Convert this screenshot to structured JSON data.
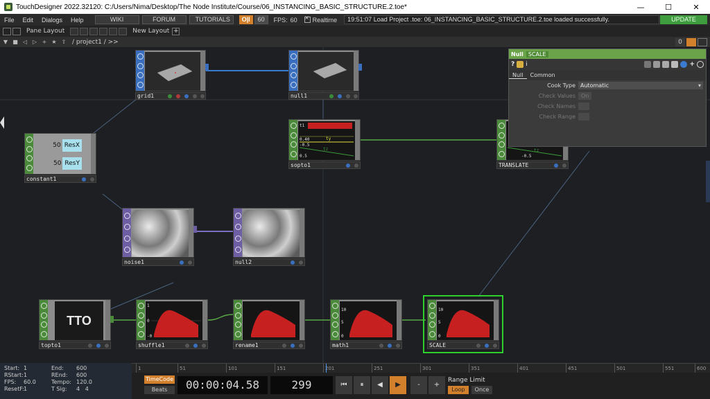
{
  "window": {
    "title": "TouchDesigner 2022.32120: C:/Users/Nima/Desktop/The Node Institute/Course/06_INSTANCING_BASIC_STRUCTURE.2.toe*",
    "minimize": "—",
    "maximize": "☐",
    "close": "✕"
  },
  "menubar": {
    "items": [
      "File",
      "Edit",
      "Dialogs",
      "Help"
    ],
    "wiki": "WIKI",
    "forum": "FORUM",
    "tutorials": "TUTORIALS",
    "oi": "O|I",
    "sixty": "60",
    "fps_label": "FPS:",
    "fps_value": "60",
    "realtime": "Realtime",
    "log": "19:51:07 Load Project .toe: 06_INSTANCING_BASIC_STRUCTURE.2.toe loaded successfully.",
    "update": "UPDATE"
  },
  "panebar": {
    "pane_layout": "Pane Layout",
    "new_layout": "New Layout",
    "plus": "+"
  },
  "pathbar": {
    "path": "/ project1 / >>",
    "zero": "0"
  },
  "nodes": {
    "grid1": "grid1",
    "null1": "null1",
    "constant1": "constant1",
    "sopto1": "sopto1",
    "translate": "TRANSLATE",
    "noise1": "noise1",
    "null2": "null2",
    "topto1": "topto1",
    "shuffle1": "shuffle1",
    "rename1": "rename1",
    "math1": "math1",
    "scale": "SCALE"
  },
  "constant": {
    "v1": "50",
    "n1": "ResX",
    "v2": "50",
    "n2": "ResY"
  },
  "topto_text": "TTO",
  "sopto_labels": {
    "a": "t1",
    "b": "0.40",
    "c": "ty",
    "d": "-0.5",
    "e": "tz",
    "f": "0.5"
  },
  "translate_labels": {
    "a": "tz",
    "b": "-0.5"
  },
  "chop_axis": {
    "shuffle_top": "1",
    "shuffle_mid": "0",
    "shuffle_bot": "-0",
    "math_top": "10",
    "math_mid": "5",
    "math_bot": "0"
  },
  "param": {
    "type": "Null",
    "name": "SCALE",
    "tabs": [
      "Null",
      "Common"
    ],
    "cook_type_label": "Cook Type",
    "cook_type_value": "Automatic",
    "check_values_label": "Check Values",
    "check_values_value": "On",
    "check_names_label": "Check Names",
    "check_range_label": "Check Range"
  },
  "timeinfo": {
    "start_label": "Start:",
    "start": "1",
    "end_label": "End:",
    "end": "600",
    "rstart_label": "RStart:",
    "rstart": "1",
    "rend_label": "REnd:",
    "rend": "600",
    "fps_label": "FPS:",
    "fps": "60.0",
    "tempo_label": "Tempo:",
    "tempo": "120.0",
    "resetf_label": "ResetF:",
    "resetf": "1",
    "tsig_label": "T Sig:",
    "tsig_a": "4",
    "tsig_b": "4"
  },
  "ruler": [
    "1",
    "51",
    "101",
    "151",
    "201",
    "251",
    "301",
    "351",
    "401",
    "451",
    "501",
    "551",
    "600"
  ],
  "transport": {
    "timecode": "TimeCode",
    "beats": "Beats",
    "clock": "00:00:04.58",
    "frame": "299",
    "rewind": "⏮",
    "pause": "⏸",
    "step_back": "◀",
    "play": "▶",
    "minus": "-",
    "plus": "+",
    "range_limit": "Range Limit",
    "loop": "Loop",
    "once": "Once"
  },
  "colors": {
    "sop": "#3a6fbf",
    "chop": "#4b8a3a",
    "top": "#6e5fa5",
    "accent": "#d2802c",
    "selected": "#2ed02e"
  }
}
